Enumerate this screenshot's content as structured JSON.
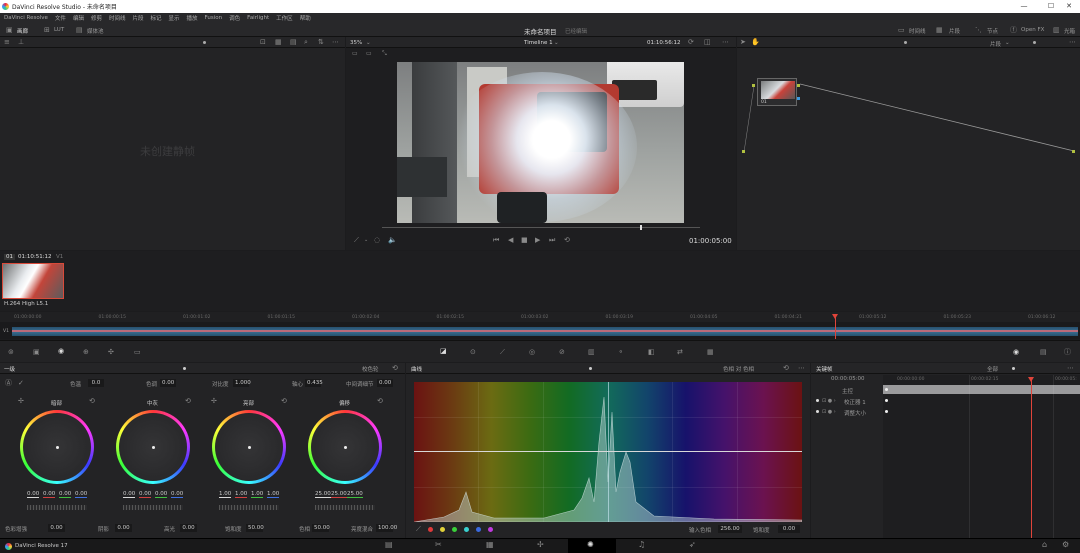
{
  "window": {
    "title": "DaVinci Resolve Studio - 未命名项目",
    "minimize": "—",
    "maximize": "☐",
    "close": "✕"
  },
  "menu": [
    "DaVinci Resolve",
    "文件",
    "编辑",
    "修剪",
    "时间线",
    "片段",
    "标记",
    "显示",
    "播放",
    "Fusion",
    "调色",
    "Fairlight",
    "工作区",
    "帮助"
  ],
  "toolbar": {
    "media": "画廊",
    "lut": "LUT",
    "clips": "媒体池",
    "project_title": "未命名项目",
    "edited": "已经编辑",
    "timeline": "时间线",
    "clips_menu": "片段",
    "nodes": "节点",
    "openfx": "Open FX",
    "lightbox": "光箱"
  },
  "viewer": {
    "zoom": "35%",
    "timeline_name": "Timeline 1",
    "timecode_top": "01:10:56:12",
    "timecode_bottom": "01:00:05:00",
    "no_gallery": "未创建静帧",
    "node_label": "01"
  },
  "node_panel": {
    "clips_label": "片段"
  },
  "clip_strip": {
    "index": "01",
    "timecode": "01:10:51:12",
    "track": "V1",
    "codec": "H.264 High L5.1"
  },
  "mini_timeline": {
    "track": "V1",
    "ticks": [
      "01:00:00:00",
      "01:00:00:15",
      "01:00:01:02",
      "01:00:01:15",
      "01:00:02:04",
      "01:00:02:15",
      "01:00:03:02",
      "01:00:03:19",
      "01:00:04:05",
      "01:00:04:21",
      "01:00:05:12",
      "01:00:05:23",
      "01:00:06:12"
    ],
    "playhead_fraction": 0.773
  },
  "color": {
    "panel_title": "一级",
    "mode": "校色轮",
    "params_top": [
      {
        "label": "色温",
        "value": "0.0"
      },
      {
        "label": "色调",
        "value": "0.00"
      },
      {
        "label": "对比度",
        "value": "1.000"
      },
      {
        "label": "轴心",
        "value": "0.435"
      },
      {
        "label": "中间调细节",
        "value": "0.00"
      }
    ],
    "wheels": [
      {
        "name": "暗部",
        "values": [
          "0.00",
          "0.00",
          "0.00",
          "0.00"
        ]
      },
      {
        "name": "中灰",
        "values": [
          "0.00",
          "0.00",
          "0.00",
          "0.00"
        ]
      },
      {
        "name": "亮部",
        "values": [
          "1.00",
          "1.00",
          "1.00",
          "1.00"
        ]
      },
      {
        "name": "偏移",
        "values": [
          "25.00",
          "25.00",
          "25.00",
          ""
        ]
      }
    ],
    "params_bottom": [
      {
        "label": "色彩增强",
        "value": "0.00"
      },
      {
        "label": "阴影",
        "value": "0.00"
      },
      {
        "label": "高光",
        "value": "0.00"
      },
      {
        "label": "饱和度",
        "value": "50.00"
      },
      {
        "label": "色相",
        "value": "50.00"
      },
      {
        "label": "亮度混合",
        "value": "100.00"
      }
    ]
  },
  "curves": {
    "title": "曲线",
    "mode": "色相 对 色相",
    "input_hue_label": "输入色相",
    "input_hue": "256.00",
    "sat_label": "饱和度",
    "sat_value": "0.00",
    "swatches": [
      "#e03a3a",
      "#e0d03a",
      "#3ad03a",
      "#3ad0d0",
      "#3a6ae0",
      "#c03ae0"
    ]
  },
  "keyframes": {
    "title": "关键帧",
    "all": "全部",
    "timecode": "00:00:05:00",
    "tick1": "00:00:00:00",
    "tick2": "00:00:02:15",
    "tick3": "00:00:05:",
    "rows": [
      {
        "label": "主控"
      },
      {
        "label": "校正器 1"
      },
      {
        "label": "调整大小"
      }
    ]
  },
  "status": {
    "app": "DaVinci Resolve 17"
  }
}
